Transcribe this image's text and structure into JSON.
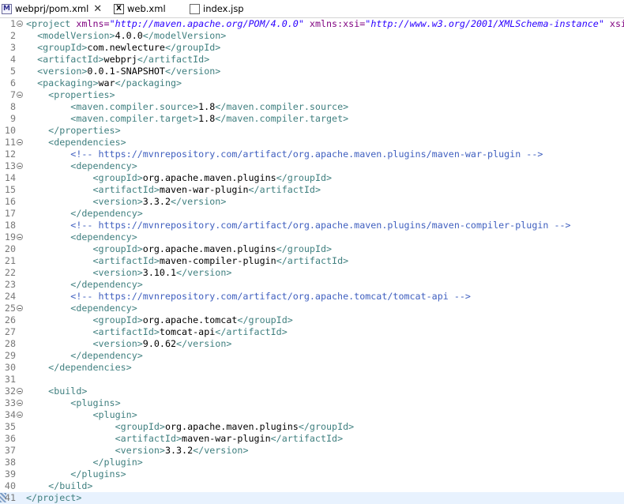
{
  "tabs": [
    {
      "label": "webprj/pom.xml",
      "active": true,
      "icon": "maven-xml-icon",
      "close": "✕"
    },
    {
      "label": "web.xml",
      "active": false,
      "icon": "xml-file-icon"
    },
    {
      "label": "index.jsp",
      "active": false,
      "icon": "jsp-file-icon"
    }
  ],
  "lines": [
    {
      "n": "1",
      "fold": true,
      "segs": [
        [
          "t",
          "<project "
        ],
        [
          "a",
          "xmlns="
        ],
        [
          "v",
          "\"http://maven.apache.org/POM/4.0.0\""
        ],
        [
          "x",
          " "
        ],
        [
          "a",
          "xmlns:xsi="
        ],
        [
          "v",
          "\"http://www.w3.org/2001/XMLSchema-instance\""
        ],
        [
          "x",
          " "
        ],
        [
          "a",
          "xsi"
        ]
      ]
    },
    {
      "n": "2",
      "segs": [
        [
          "x",
          "  "
        ],
        [
          "t",
          "<modelVersion>"
        ],
        [
          "x",
          "4.0.0"
        ],
        [
          "t",
          "</modelVersion>"
        ]
      ]
    },
    {
      "n": "3",
      "segs": [
        [
          "x",
          "  "
        ],
        [
          "t",
          "<groupId>"
        ],
        [
          "x",
          "com.newlecture"
        ],
        [
          "t",
          "</groupId>"
        ]
      ]
    },
    {
      "n": "4",
      "segs": [
        [
          "x",
          "  "
        ],
        [
          "t",
          "<artifactId>"
        ],
        [
          "x",
          "webprj"
        ],
        [
          "t",
          "</artifactId>"
        ]
      ]
    },
    {
      "n": "5",
      "segs": [
        [
          "x",
          "  "
        ],
        [
          "t",
          "<version>"
        ],
        [
          "x",
          "0.0.1-SNAPSHOT"
        ],
        [
          "t",
          "</version>"
        ]
      ]
    },
    {
      "n": "6",
      "segs": [
        [
          "x",
          "  "
        ],
        [
          "t",
          "<packaging>"
        ],
        [
          "x",
          "war"
        ],
        [
          "t",
          "</packaging>"
        ]
      ]
    },
    {
      "n": "7",
      "fold": true,
      "segs": [
        [
          "x",
          "    "
        ],
        [
          "t",
          "<properties>"
        ]
      ]
    },
    {
      "n": "8",
      "segs": [
        [
          "x",
          "        "
        ],
        [
          "t",
          "<maven.compiler.source>"
        ],
        [
          "x",
          "1.8"
        ],
        [
          "t",
          "</maven.compiler.source>"
        ]
      ]
    },
    {
      "n": "9",
      "segs": [
        [
          "x",
          "        "
        ],
        [
          "t",
          "<maven.compiler.target>"
        ],
        [
          "x",
          "1.8"
        ],
        [
          "t",
          "</maven.compiler.target>"
        ]
      ]
    },
    {
      "n": "10",
      "segs": [
        [
          "x",
          "    "
        ],
        [
          "t",
          "</properties>"
        ]
      ]
    },
    {
      "n": "11",
      "fold": true,
      "segs": [
        [
          "x",
          "    "
        ],
        [
          "t",
          "<dependencies>"
        ]
      ]
    },
    {
      "n": "12",
      "segs": [
        [
          "x",
          "        "
        ],
        [
          "c",
          "<!-- https://mvnrepository.com/artifact/org.apache.maven.plugins/maven-war-plugin -->"
        ]
      ]
    },
    {
      "n": "13",
      "fold": true,
      "segs": [
        [
          "x",
          "        "
        ],
        [
          "t",
          "<dependency>"
        ]
      ]
    },
    {
      "n": "14",
      "segs": [
        [
          "x",
          "            "
        ],
        [
          "t",
          "<groupId>"
        ],
        [
          "x",
          "org.apache.maven.plugins"
        ],
        [
          "t",
          "</groupId>"
        ]
      ]
    },
    {
      "n": "15",
      "segs": [
        [
          "x",
          "            "
        ],
        [
          "t",
          "<artifactId>"
        ],
        [
          "x",
          "maven-war-plugin"
        ],
        [
          "t",
          "</artifactId>"
        ]
      ]
    },
    {
      "n": "16",
      "segs": [
        [
          "x",
          "            "
        ],
        [
          "t",
          "<version>"
        ],
        [
          "x",
          "3.3.2"
        ],
        [
          "t",
          "</version>"
        ]
      ]
    },
    {
      "n": "17",
      "segs": [
        [
          "x",
          "        "
        ],
        [
          "t",
          "</dependency>"
        ]
      ]
    },
    {
      "n": "18",
      "segs": [
        [
          "x",
          "        "
        ],
        [
          "c",
          "<!-- https://mvnrepository.com/artifact/org.apache.maven.plugins/maven-compiler-plugin -->"
        ]
      ]
    },
    {
      "n": "19",
      "fold": true,
      "segs": [
        [
          "x",
          "        "
        ],
        [
          "t",
          "<dependency>"
        ]
      ]
    },
    {
      "n": "20",
      "segs": [
        [
          "x",
          "            "
        ],
        [
          "t",
          "<groupId>"
        ],
        [
          "x",
          "org.apache.maven.plugins"
        ],
        [
          "t",
          "</groupId>"
        ]
      ]
    },
    {
      "n": "21",
      "segs": [
        [
          "x",
          "            "
        ],
        [
          "t",
          "<artifactId>"
        ],
        [
          "x",
          "maven-compiler-plugin"
        ],
        [
          "t",
          "</artifactId>"
        ]
      ]
    },
    {
      "n": "22",
      "segs": [
        [
          "x",
          "            "
        ],
        [
          "t",
          "<version>"
        ],
        [
          "x",
          "3.10.1"
        ],
        [
          "t",
          "</version>"
        ]
      ]
    },
    {
      "n": "23",
      "segs": [
        [
          "x",
          "        "
        ],
        [
          "t",
          "</dependency>"
        ]
      ]
    },
    {
      "n": "24",
      "segs": [
        [
          "x",
          "        "
        ],
        [
          "c",
          "<!-- https://mvnrepository.com/artifact/org.apache.tomcat/tomcat-api -->"
        ]
      ]
    },
    {
      "n": "25",
      "fold": true,
      "segs": [
        [
          "x",
          "        "
        ],
        [
          "t",
          "<dependency>"
        ]
      ]
    },
    {
      "n": "26",
      "segs": [
        [
          "x",
          "            "
        ],
        [
          "t",
          "<groupId>"
        ],
        [
          "x",
          "org.apache.tomcat"
        ],
        [
          "t",
          "</groupId>"
        ]
      ]
    },
    {
      "n": "27",
      "segs": [
        [
          "x",
          "            "
        ],
        [
          "t",
          "<artifactId>"
        ],
        [
          "x",
          "tomcat-api"
        ],
        [
          "t",
          "</artifactId>"
        ]
      ]
    },
    {
      "n": "28",
      "segs": [
        [
          "x",
          "            "
        ],
        [
          "t",
          "<version>"
        ],
        [
          "x",
          "9.0.62"
        ],
        [
          "t",
          "</version>"
        ]
      ]
    },
    {
      "n": "29",
      "segs": [
        [
          "x",
          "        "
        ],
        [
          "t",
          "</dependency>"
        ]
      ]
    },
    {
      "n": "30",
      "segs": [
        [
          "x",
          "    "
        ],
        [
          "t",
          "</dependencies>"
        ]
      ]
    },
    {
      "n": "31",
      "segs": []
    },
    {
      "n": "32",
      "fold": true,
      "segs": [
        [
          "x",
          "    "
        ],
        [
          "t",
          "<build>"
        ]
      ]
    },
    {
      "n": "33",
      "fold": true,
      "segs": [
        [
          "x",
          "        "
        ],
        [
          "t",
          "<plugins>"
        ]
      ]
    },
    {
      "n": "34",
      "fold": true,
      "segs": [
        [
          "x",
          "            "
        ],
        [
          "t",
          "<plugin>"
        ]
      ]
    },
    {
      "n": "35",
      "segs": [
        [
          "x",
          "                "
        ],
        [
          "t",
          "<groupId>"
        ],
        [
          "x",
          "org.apache.maven.plugins"
        ],
        [
          "t",
          "</groupId>"
        ]
      ]
    },
    {
      "n": "36",
      "segs": [
        [
          "x",
          "                "
        ],
        [
          "t",
          "<artifactId>"
        ],
        [
          "x",
          "maven-war-plugin"
        ],
        [
          "t",
          "</artifactId>"
        ]
      ]
    },
    {
      "n": "37",
      "segs": [
        [
          "x",
          "                "
        ],
        [
          "t",
          "<version>"
        ],
        [
          "x",
          "3.3.2"
        ],
        [
          "t",
          "</version>"
        ]
      ]
    },
    {
      "n": "38",
      "segs": [
        [
          "x",
          "            "
        ],
        [
          "t",
          "</plugin>"
        ]
      ]
    },
    {
      "n": "39",
      "segs": [
        [
          "x",
          "        "
        ],
        [
          "t",
          "</plugins>"
        ]
      ]
    },
    {
      "n": "40",
      "segs": [
        [
          "x",
          "    "
        ],
        [
          "t",
          "</build>"
        ]
      ]
    },
    {
      "n": "41",
      "current": true,
      "marker": true,
      "segs": [
        [
          "t",
          "</project>"
        ]
      ]
    }
  ]
}
